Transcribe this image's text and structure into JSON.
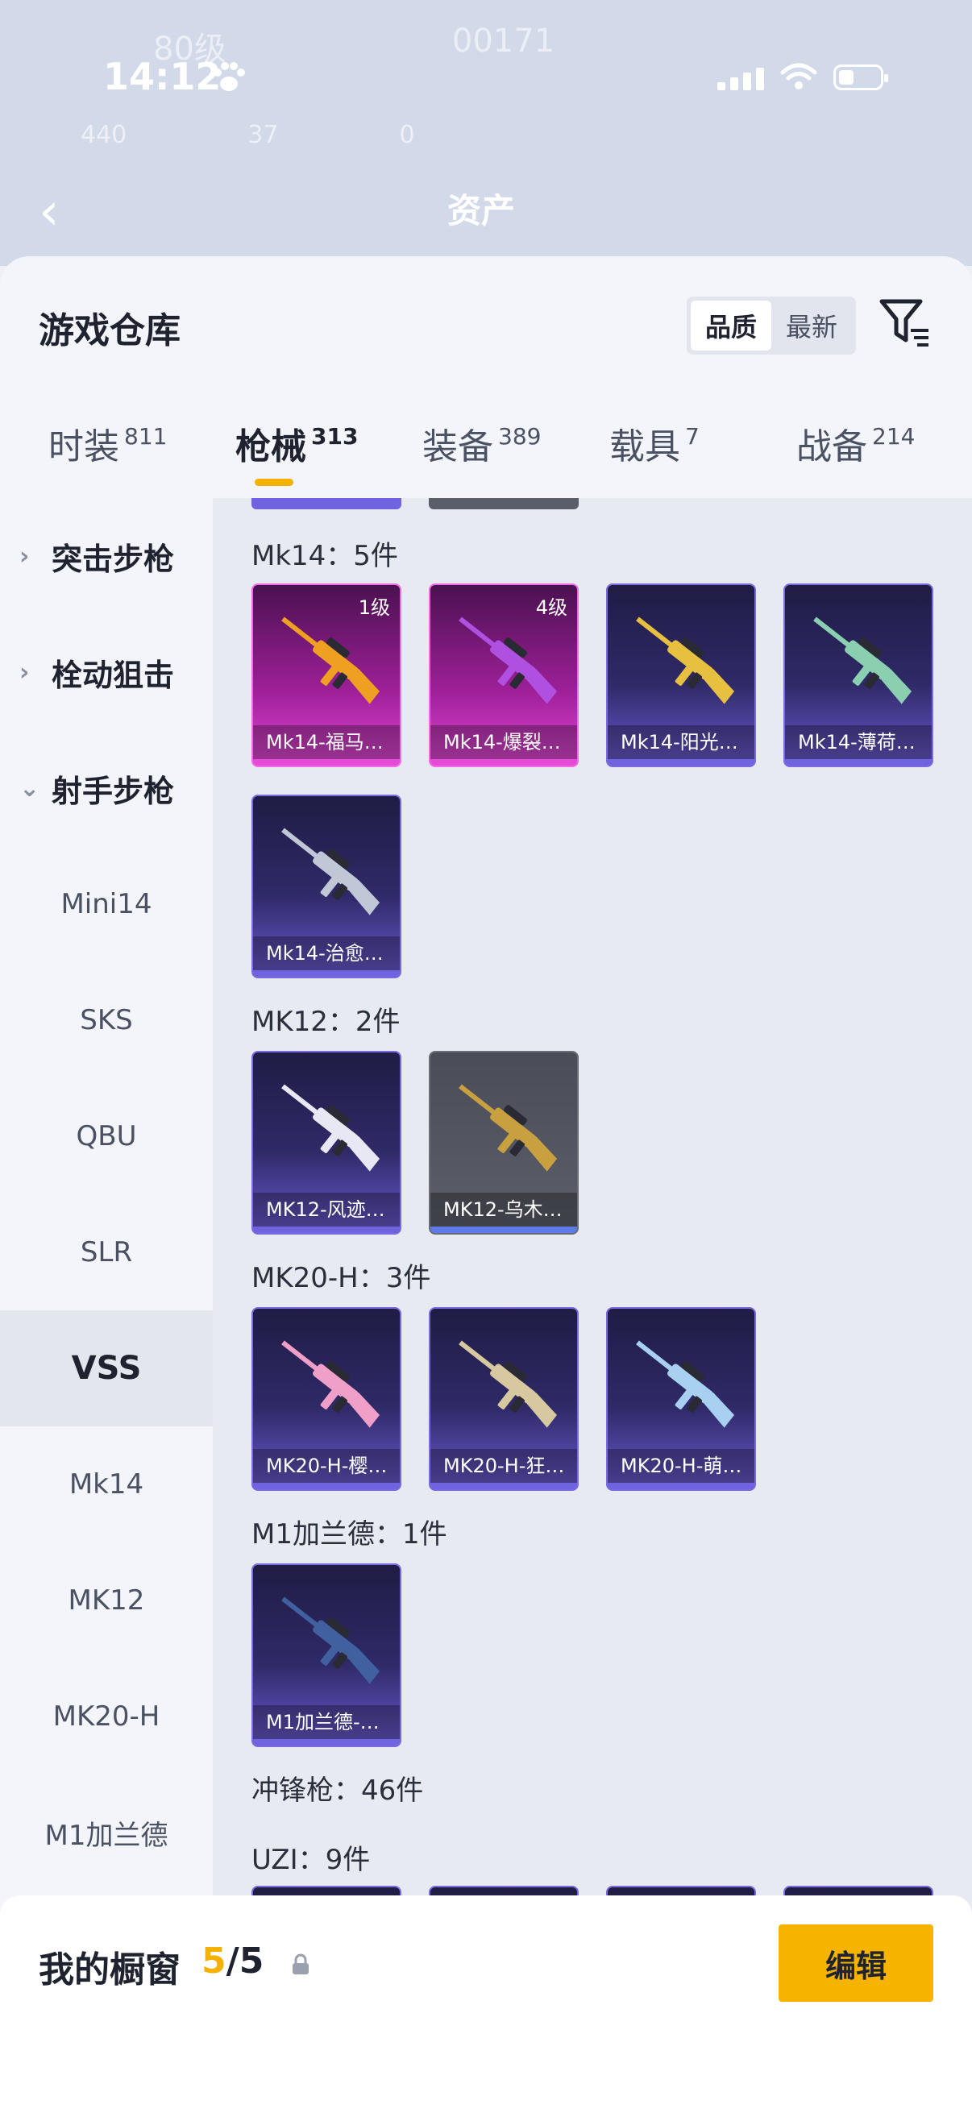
{
  "status_bar": {
    "time": "14:12"
  },
  "background": {
    "title": "资产",
    "faded_row": [
      "440",
      "37",
      "0"
    ],
    "faded_row2": [
      "80级",
      "00171"
    ]
  },
  "sheet": {
    "title": "游戏仓库",
    "sort": [
      "品质",
      "最新"
    ],
    "sort_selected": "品质"
  },
  "tabs": [
    {
      "label": "时装",
      "count": "811"
    },
    {
      "label": "枪械",
      "count": "313"
    },
    {
      "label": "装备",
      "count": "389"
    },
    {
      "label": "载具",
      "count": "7"
    },
    {
      "label": "战备",
      "count": "214"
    }
  ],
  "sidebar": {
    "groups": [
      "突击步枪",
      "栓动狙击",
      "射手步枪"
    ],
    "items": [
      "Mini14",
      "SKS",
      "QBU",
      "SLR",
      "VSS",
      "Mk14",
      "MK12",
      "MK20-H",
      "M1加兰德"
    ],
    "active": "VSS"
  },
  "sections": [
    {
      "label": "Mk14：5件"
    },
    {
      "label": "MK12：2件"
    },
    {
      "label": "MK20-H：3件"
    },
    {
      "label": "M1加兰德：1件"
    },
    {
      "label": "冲锋枪：46件"
    },
    {
      "label": "UZI：9件"
    }
  ],
  "cards": [
    {
      "name": "Mk14-福马…",
      "level": "1级",
      "rarity": "pink",
      "gun_color": "#f0a020"
    },
    {
      "name": "Mk14-爆裂…",
      "level": "4级",
      "rarity": "pink",
      "gun_color": "#b050e0"
    },
    {
      "name": "Mk14-阳光…",
      "level": "",
      "rarity": "purple",
      "gun_color": "#e8c040"
    },
    {
      "name": "Mk14-薄荷…",
      "level": "",
      "rarity": "purple",
      "gun_color": "#8ad0b0"
    },
    {
      "name": "Mk14-治愈…",
      "level": "",
      "rarity": "purple",
      "gun_color": "#c0c8d8"
    },
    {
      "name": "MK12-风迹…",
      "level": "",
      "rarity": "purple",
      "gun_color": "#e8e8f4"
    },
    {
      "name": "MK12-乌木…",
      "level": "",
      "rarity": "gray",
      "gun_color": "#c8a040"
    },
    {
      "name": "MK20-H-樱…",
      "level": "",
      "rarity": "purple",
      "gun_color": "#f0a0c8"
    },
    {
      "name": "MK20-H-狂…",
      "level": "",
      "rarity": "purple",
      "gun_color": "#d8c8a0"
    },
    {
      "name": "MK20-H-萌…",
      "level": "",
      "rarity": "purple",
      "gun_color": "#a8d0f0"
    },
    {
      "name": "M1加兰德-…",
      "level": "",
      "rarity": "purple",
      "gun_color": "#4060a0"
    }
  ],
  "icons": {
    "filter": "filter-icon",
    "share": "external-link-icon",
    "lock": "lock-icon",
    "back": "back-chevron-icon"
  },
  "bottom_bar": {
    "label": "我的橱窗",
    "current": "5",
    "total": "/5",
    "edit_label": "编辑"
  },
  "colors": {
    "accent": "#f6b400",
    "pink_rarity": "#e64bd8",
    "purple_rarity": "#6f63e0"
  }
}
